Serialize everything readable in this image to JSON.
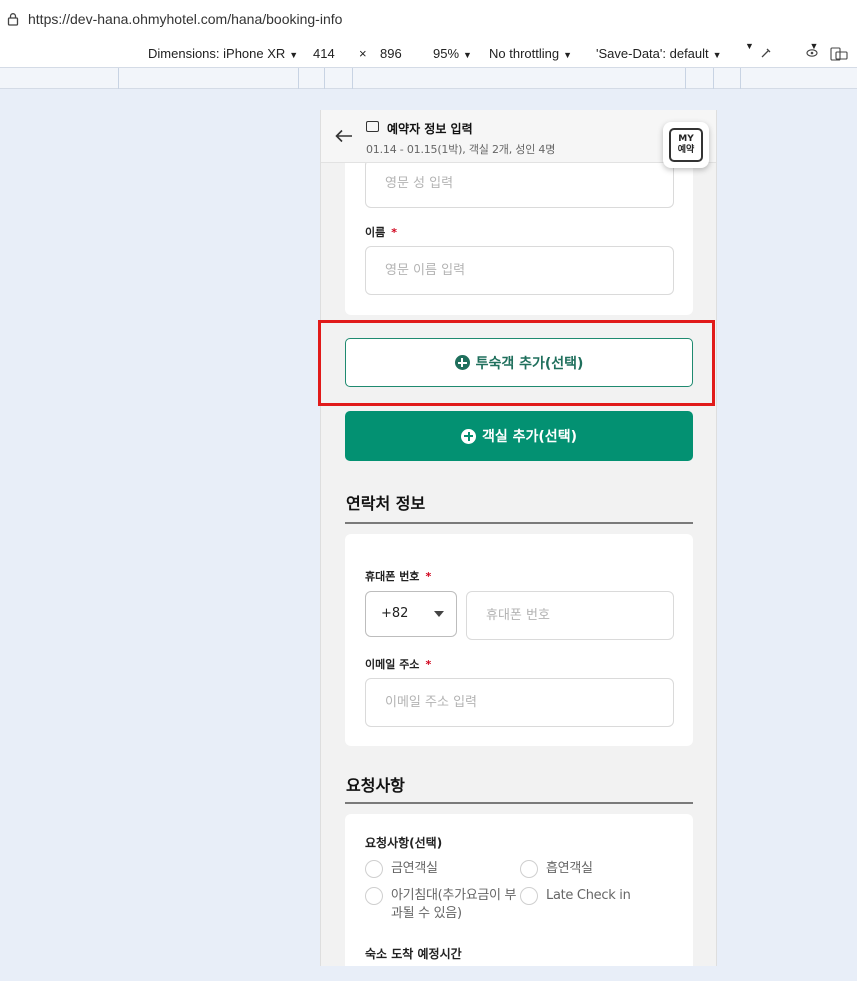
{
  "browser": {
    "url": "https://dev-hana.ohmyhotel.com/hana/booking-info"
  },
  "devtools": {
    "dimensions_label": "Dimensions: iPhone XR",
    "width": "414",
    "times": "×",
    "height": "896",
    "zoom": "95%",
    "throttling": "No throttling",
    "save_data": "'Save-Data': default"
  },
  "header": {
    "title": "예약자 정보 입력",
    "subtitle": "01.14 - 01.15(1박), 객실 2개, 성인 4명",
    "my_line1": "MY",
    "my_line2": "예약"
  },
  "guest_form": {
    "last_name_placeholder": "영문 성 입력",
    "first_name_label": "이름",
    "required_mark": "*",
    "first_name_placeholder": "영문 이름 입력"
  },
  "buttons": {
    "add_guest": "투숙객 추가(선택)",
    "add_room": "객실 추가(선택)"
  },
  "contact": {
    "section_title": "연락처 정보",
    "phone_label": "휴대폰 번호",
    "country_code": "+82",
    "phone_placeholder": "휴대폰 번호",
    "email_label": "이메일 주소",
    "email_placeholder": "이메일 주소 입력"
  },
  "requests": {
    "section_title": "요청사항",
    "group_label": "요청사항(선택)",
    "options": [
      "금연객실",
      "흡연객실",
      "아기침대(추가요금이 부과될 수 있음)",
      "Late Check in"
    ],
    "arrival_label": "숙소 도착 예정시간"
  }
}
